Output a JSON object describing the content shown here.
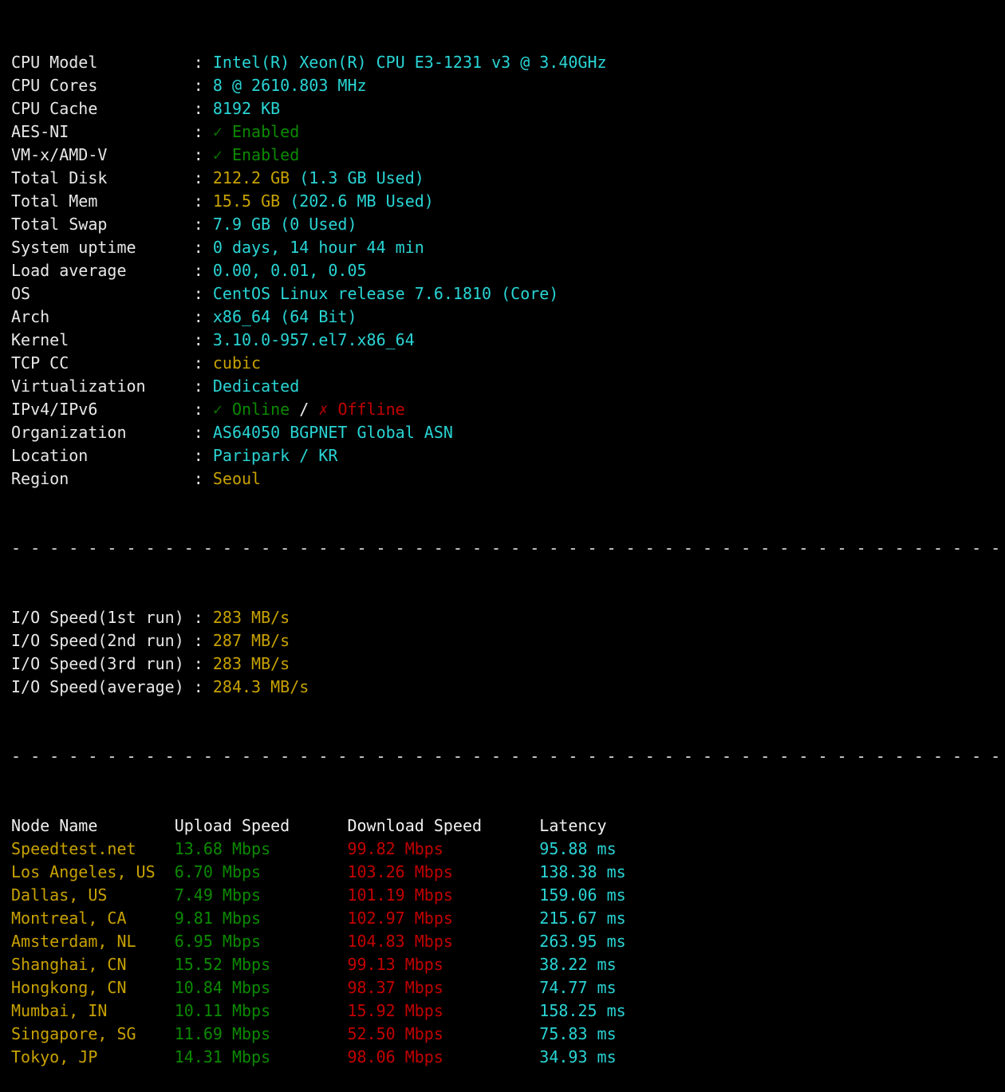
{
  "terminal": {
    "background": "#000000",
    "colors": {
      "label": "#e8e8e8",
      "cyan": "#2ad4d4",
      "yellow": "#c8a200",
      "green": "#0b8a00",
      "red": "#c20000",
      "white": "#f0f0f0"
    },
    "separator_dashes": "- - - - - - - - - - - - - - - - - - - - - - - - - - - - - - - - - - - - - - - - - - - - - - - - - - - - - - - - - - - - - - - - - - - - - - - - -",
    "colon": ":",
    "check_icon": "✓",
    "cross_icon": "✗",
    "slash": "/"
  },
  "system_info": {
    "rows": [
      {
        "label": "CPU Model",
        "value": "Intel(R) Xeon(R) CPU E3-1231 v3 @ 3.40GHz",
        "style": "cyan"
      },
      {
        "label": "CPU Cores",
        "value": "8 @ 2610.803 MHz",
        "style": "cyan"
      },
      {
        "label": "CPU Cache",
        "value": "8192 KB",
        "style": "cyan"
      },
      {
        "label": "AES-NI",
        "value": "Enabled",
        "style": "check-green"
      },
      {
        "label": "VM-x/AMD-V",
        "value": "Enabled",
        "style": "check-green"
      },
      {
        "label": "Total Disk",
        "value": "212.2 GB",
        "suffix": " (1.3 GB Used)",
        "style": "yellow-cyan"
      },
      {
        "label": "Total Mem",
        "value": "15.5 GB",
        "suffix": " (202.6 MB Used)",
        "style": "yellow-cyan"
      },
      {
        "label": "Total Swap",
        "value": "7.9 GB (0 Used)",
        "style": "cyan"
      },
      {
        "label": "System uptime",
        "value": "0 days, 14 hour 44 min",
        "style": "cyan"
      },
      {
        "label": "Load average",
        "value": "0.00, 0.01, 0.05",
        "style": "cyan"
      },
      {
        "label": "OS",
        "value": "CentOS Linux release 7.6.1810 (Core)",
        "style": "cyan"
      },
      {
        "label": "Arch",
        "value": "x86_64 (64 Bit)",
        "style": "cyan"
      },
      {
        "label": "Kernel",
        "value": "3.10.0-957.el7.x86_64",
        "style": "cyan"
      },
      {
        "label": "TCP CC",
        "value": "cubic",
        "style": "yellow"
      },
      {
        "label": "Virtualization",
        "value": "Dedicated",
        "style": "cyan"
      },
      {
        "label": "IPv4/IPv6",
        "value_online": "Online",
        "value_offline": "Offline",
        "style": "online-offline"
      },
      {
        "label": "Organization",
        "value": "AS64050 BGPNET Global ASN",
        "style": "cyan"
      },
      {
        "label": "Location",
        "value": "Paripark / KR",
        "style": "cyan"
      },
      {
        "label": "Region",
        "value": "Seoul",
        "style": "yellow"
      }
    ]
  },
  "io_speed": {
    "rows": [
      {
        "label": "I/O Speed(1st run)",
        "value": "283 MB/s"
      },
      {
        "label": "I/O Speed(2nd run)",
        "value": "287 MB/s"
      },
      {
        "label": "I/O Speed(3rd run)",
        "value": "283 MB/s"
      },
      {
        "label": "I/O Speed(average)",
        "value": "284.3 MB/s"
      }
    ]
  },
  "speedtest": {
    "headers": {
      "node": "Node Name",
      "upload": "Upload Speed",
      "download": "Download Speed",
      "latency": "Latency"
    },
    "rows": [
      {
        "node": "Speedtest.net",
        "upload": "13.68 Mbps",
        "download": "99.82 Mbps",
        "latency": "95.88 ms"
      },
      {
        "node": "Los Angeles, US",
        "upload": "6.70 Mbps",
        "download": "103.26 Mbps",
        "latency": "138.38 ms"
      },
      {
        "node": "Dallas, US",
        "upload": "7.49 Mbps",
        "download": "101.19 Mbps",
        "latency": "159.06 ms"
      },
      {
        "node": "Montreal, CA",
        "upload": "9.81 Mbps",
        "download": "102.97 Mbps",
        "latency": "215.67 ms"
      },
      {
        "node": "Amsterdam, NL",
        "upload": "6.95 Mbps",
        "download": "104.83 Mbps",
        "latency": "263.95 ms"
      },
      {
        "node": "Shanghai, CN",
        "upload": "15.52 Mbps",
        "download": "99.13 Mbps",
        "latency": "38.22 ms"
      },
      {
        "node": "Hongkong, CN",
        "upload": "10.84 Mbps",
        "download": "98.37 Mbps",
        "latency": "74.77 ms"
      },
      {
        "node": "Mumbai, IN",
        "upload": "10.11 Mbps",
        "download": "15.92 Mbps",
        "latency": "158.25 ms"
      },
      {
        "node": "Singapore, SG",
        "upload": "11.69 Mbps",
        "download": "52.50 Mbps",
        "latency": "75.83 ms"
      },
      {
        "node": "Tokyo, JP",
        "upload": "14.31 Mbps",
        "download": "98.06 Mbps",
        "latency": "34.93 ms"
      }
    ]
  }
}
